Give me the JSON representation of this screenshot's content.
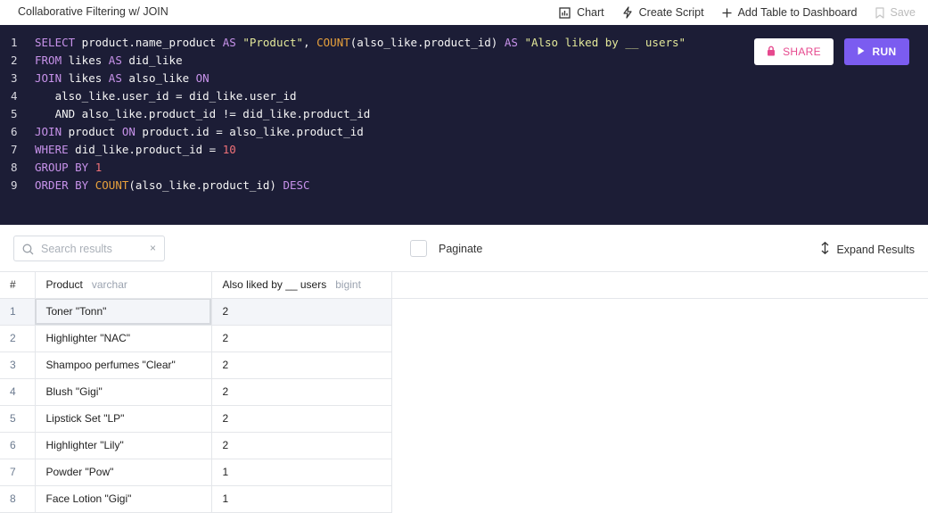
{
  "topbar": {
    "title": "Collaborative Filtering w/ JOIN",
    "chart_label": "Chart",
    "create_script_label": "Create Script",
    "add_table_label": "Add Table to Dashboard",
    "save_label": "Save"
  },
  "editor": {
    "share_label": "SHARE",
    "run_label": "RUN",
    "colors": {
      "background": "#1c1d36",
      "keyword": "#c792ea",
      "function": "#e8a13c",
      "string": "#e3e89a",
      "number": "#f07178",
      "run_button": "#7b5cf0",
      "share_text": "#e6498e"
    },
    "lines": [
      {
        "n": "1",
        "tokens": [
          [
            "kw",
            "SELECT"
          ],
          [
            "txt",
            " product.name_product "
          ],
          [
            "kw",
            "AS"
          ],
          [
            "str",
            " \"Product\""
          ],
          [
            "txt",
            ", "
          ],
          [
            "fn",
            "COUNT"
          ],
          [
            "txt",
            "(also_like.product_id) "
          ],
          [
            "kw",
            "AS"
          ],
          [
            "str",
            " \"Also liked by __ users\""
          ]
        ]
      },
      {
        "n": "2",
        "tokens": [
          [
            "kw",
            "FROM"
          ],
          [
            "txt",
            " likes "
          ],
          [
            "kw",
            "AS"
          ],
          [
            "txt",
            " did_like"
          ]
        ]
      },
      {
        "n": "3",
        "tokens": [
          [
            "kw",
            "JOIN"
          ],
          [
            "txt",
            " likes "
          ],
          [
            "kw",
            "AS"
          ],
          [
            "txt",
            " also_like "
          ],
          [
            "kw",
            "ON"
          ]
        ]
      },
      {
        "n": "4",
        "tokens": [
          [
            "txt",
            "   also_like.user_id = did_like.user_id"
          ]
        ]
      },
      {
        "n": "5",
        "tokens": [
          [
            "txt",
            "   AND also_like.product_id != did_like.product_id"
          ]
        ]
      },
      {
        "n": "6",
        "tokens": [
          [
            "kw",
            "JOIN"
          ],
          [
            "txt",
            " product "
          ],
          [
            "kw",
            "ON"
          ],
          [
            "txt",
            " product.id = also_like.product_id"
          ]
        ]
      },
      {
        "n": "7",
        "tokens": [
          [
            "kw",
            "WHERE"
          ],
          [
            "txt",
            " did_like.product_id = "
          ],
          [
            "num",
            "10"
          ]
        ]
      },
      {
        "n": "8",
        "tokens": [
          [
            "kw",
            "GROUP BY"
          ],
          [
            "txt",
            " "
          ],
          [
            "num",
            "1"
          ]
        ]
      },
      {
        "n": "9",
        "tokens": [
          [
            "kw",
            "ORDER BY"
          ],
          [
            "txt",
            " "
          ],
          [
            "fn",
            "COUNT"
          ],
          [
            "txt",
            "(also_like.product_id) "
          ],
          [
            "kw",
            "DESC"
          ]
        ]
      }
    ]
  },
  "results": {
    "search_placeholder": "Search results",
    "clear_symbol": "×",
    "paginate_label": "Paginate",
    "expand_label": "Expand Results",
    "columns": [
      {
        "label": "#",
        "type": ""
      },
      {
        "label": "Product",
        "type": "varchar"
      },
      {
        "label": "Also liked by __ users",
        "type": "bigint"
      }
    ],
    "rows": [
      {
        "n": "1",
        "product": "Toner \"Tonn\"",
        "count": "2"
      },
      {
        "n": "2",
        "product": "Highlighter \"NAC\"",
        "count": "2"
      },
      {
        "n": "3",
        "product": "Shampoo perfumes \"Clear\"",
        "count": "2"
      },
      {
        "n": "4",
        "product": "Blush \"Gigi\"",
        "count": "2"
      },
      {
        "n": "5",
        "product": "Lipstick Set \"LP\"",
        "count": "2"
      },
      {
        "n": "6",
        "product": "Highlighter \"Lily\"",
        "count": "2"
      },
      {
        "n": "7",
        "product": "Powder \"Pow\"",
        "count": "1"
      },
      {
        "n": "8",
        "product": "Face Lotion \"Gigi\"",
        "count": "1"
      }
    ]
  }
}
